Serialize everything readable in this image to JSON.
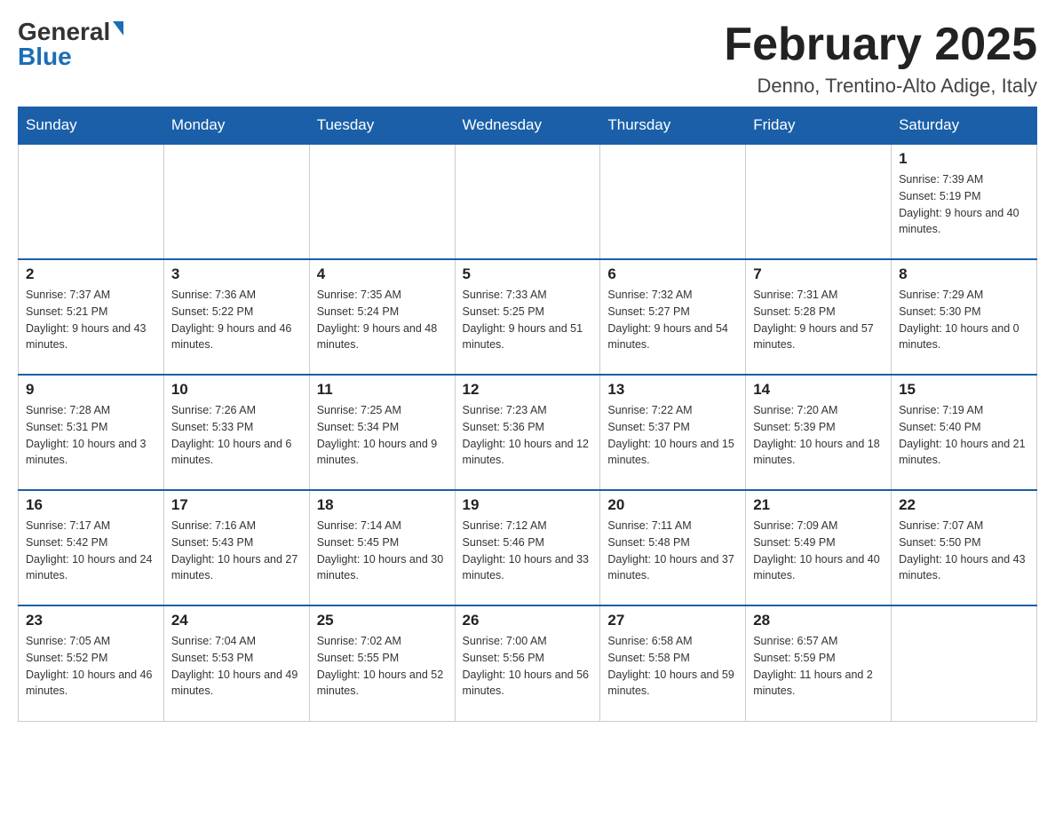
{
  "header": {
    "logo_general": "General",
    "logo_blue": "Blue",
    "month_title": "February 2025",
    "location": "Denno, Trentino-Alto Adige, Italy"
  },
  "days_of_week": [
    "Sunday",
    "Monday",
    "Tuesday",
    "Wednesday",
    "Thursday",
    "Friday",
    "Saturday"
  ],
  "weeks": [
    {
      "days": [
        {
          "num": "",
          "info": ""
        },
        {
          "num": "",
          "info": ""
        },
        {
          "num": "",
          "info": ""
        },
        {
          "num": "",
          "info": ""
        },
        {
          "num": "",
          "info": ""
        },
        {
          "num": "",
          "info": ""
        },
        {
          "num": "1",
          "info": "Sunrise: 7:39 AM\nSunset: 5:19 PM\nDaylight: 9 hours and 40 minutes."
        }
      ]
    },
    {
      "days": [
        {
          "num": "2",
          "info": "Sunrise: 7:37 AM\nSunset: 5:21 PM\nDaylight: 9 hours and 43 minutes."
        },
        {
          "num": "3",
          "info": "Sunrise: 7:36 AM\nSunset: 5:22 PM\nDaylight: 9 hours and 46 minutes."
        },
        {
          "num": "4",
          "info": "Sunrise: 7:35 AM\nSunset: 5:24 PM\nDaylight: 9 hours and 48 minutes."
        },
        {
          "num": "5",
          "info": "Sunrise: 7:33 AM\nSunset: 5:25 PM\nDaylight: 9 hours and 51 minutes."
        },
        {
          "num": "6",
          "info": "Sunrise: 7:32 AM\nSunset: 5:27 PM\nDaylight: 9 hours and 54 minutes."
        },
        {
          "num": "7",
          "info": "Sunrise: 7:31 AM\nSunset: 5:28 PM\nDaylight: 9 hours and 57 minutes."
        },
        {
          "num": "8",
          "info": "Sunrise: 7:29 AM\nSunset: 5:30 PM\nDaylight: 10 hours and 0 minutes."
        }
      ]
    },
    {
      "days": [
        {
          "num": "9",
          "info": "Sunrise: 7:28 AM\nSunset: 5:31 PM\nDaylight: 10 hours and 3 minutes."
        },
        {
          "num": "10",
          "info": "Sunrise: 7:26 AM\nSunset: 5:33 PM\nDaylight: 10 hours and 6 minutes."
        },
        {
          "num": "11",
          "info": "Sunrise: 7:25 AM\nSunset: 5:34 PM\nDaylight: 10 hours and 9 minutes."
        },
        {
          "num": "12",
          "info": "Sunrise: 7:23 AM\nSunset: 5:36 PM\nDaylight: 10 hours and 12 minutes."
        },
        {
          "num": "13",
          "info": "Sunrise: 7:22 AM\nSunset: 5:37 PM\nDaylight: 10 hours and 15 minutes."
        },
        {
          "num": "14",
          "info": "Sunrise: 7:20 AM\nSunset: 5:39 PM\nDaylight: 10 hours and 18 minutes."
        },
        {
          "num": "15",
          "info": "Sunrise: 7:19 AM\nSunset: 5:40 PM\nDaylight: 10 hours and 21 minutes."
        }
      ]
    },
    {
      "days": [
        {
          "num": "16",
          "info": "Sunrise: 7:17 AM\nSunset: 5:42 PM\nDaylight: 10 hours and 24 minutes."
        },
        {
          "num": "17",
          "info": "Sunrise: 7:16 AM\nSunset: 5:43 PM\nDaylight: 10 hours and 27 minutes."
        },
        {
          "num": "18",
          "info": "Sunrise: 7:14 AM\nSunset: 5:45 PM\nDaylight: 10 hours and 30 minutes."
        },
        {
          "num": "19",
          "info": "Sunrise: 7:12 AM\nSunset: 5:46 PM\nDaylight: 10 hours and 33 minutes."
        },
        {
          "num": "20",
          "info": "Sunrise: 7:11 AM\nSunset: 5:48 PM\nDaylight: 10 hours and 37 minutes."
        },
        {
          "num": "21",
          "info": "Sunrise: 7:09 AM\nSunset: 5:49 PM\nDaylight: 10 hours and 40 minutes."
        },
        {
          "num": "22",
          "info": "Sunrise: 7:07 AM\nSunset: 5:50 PM\nDaylight: 10 hours and 43 minutes."
        }
      ]
    },
    {
      "days": [
        {
          "num": "23",
          "info": "Sunrise: 7:05 AM\nSunset: 5:52 PM\nDaylight: 10 hours and 46 minutes."
        },
        {
          "num": "24",
          "info": "Sunrise: 7:04 AM\nSunset: 5:53 PM\nDaylight: 10 hours and 49 minutes."
        },
        {
          "num": "25",
          "info": "Sunrise: 7:02 AM\nSunset: 5:55 PM\nDaylight: 10 hours and 52 minutes."
        },
        {
          "num": "26",
          "info": "Sunrise: 7:00 AM\nSunset: 5:56 PM\nDaylight: 10 hours and 56 minutes."
        },
        {
          "num": "27",
          "info": "Sunrise: 6:58 AM\nSunset: 5:58 PM\nDaylight: 10 hours and 59 minutes."
        },
        {
          "num": "28",
          "info": "Sunrise: 6:57 AM\nSunset: 5:59 PM\nDaylight: 11 hours and 2 minutes."
        },
        {
          "num": "",
          "info": ""
        }
      ]
    }
  ]
}
